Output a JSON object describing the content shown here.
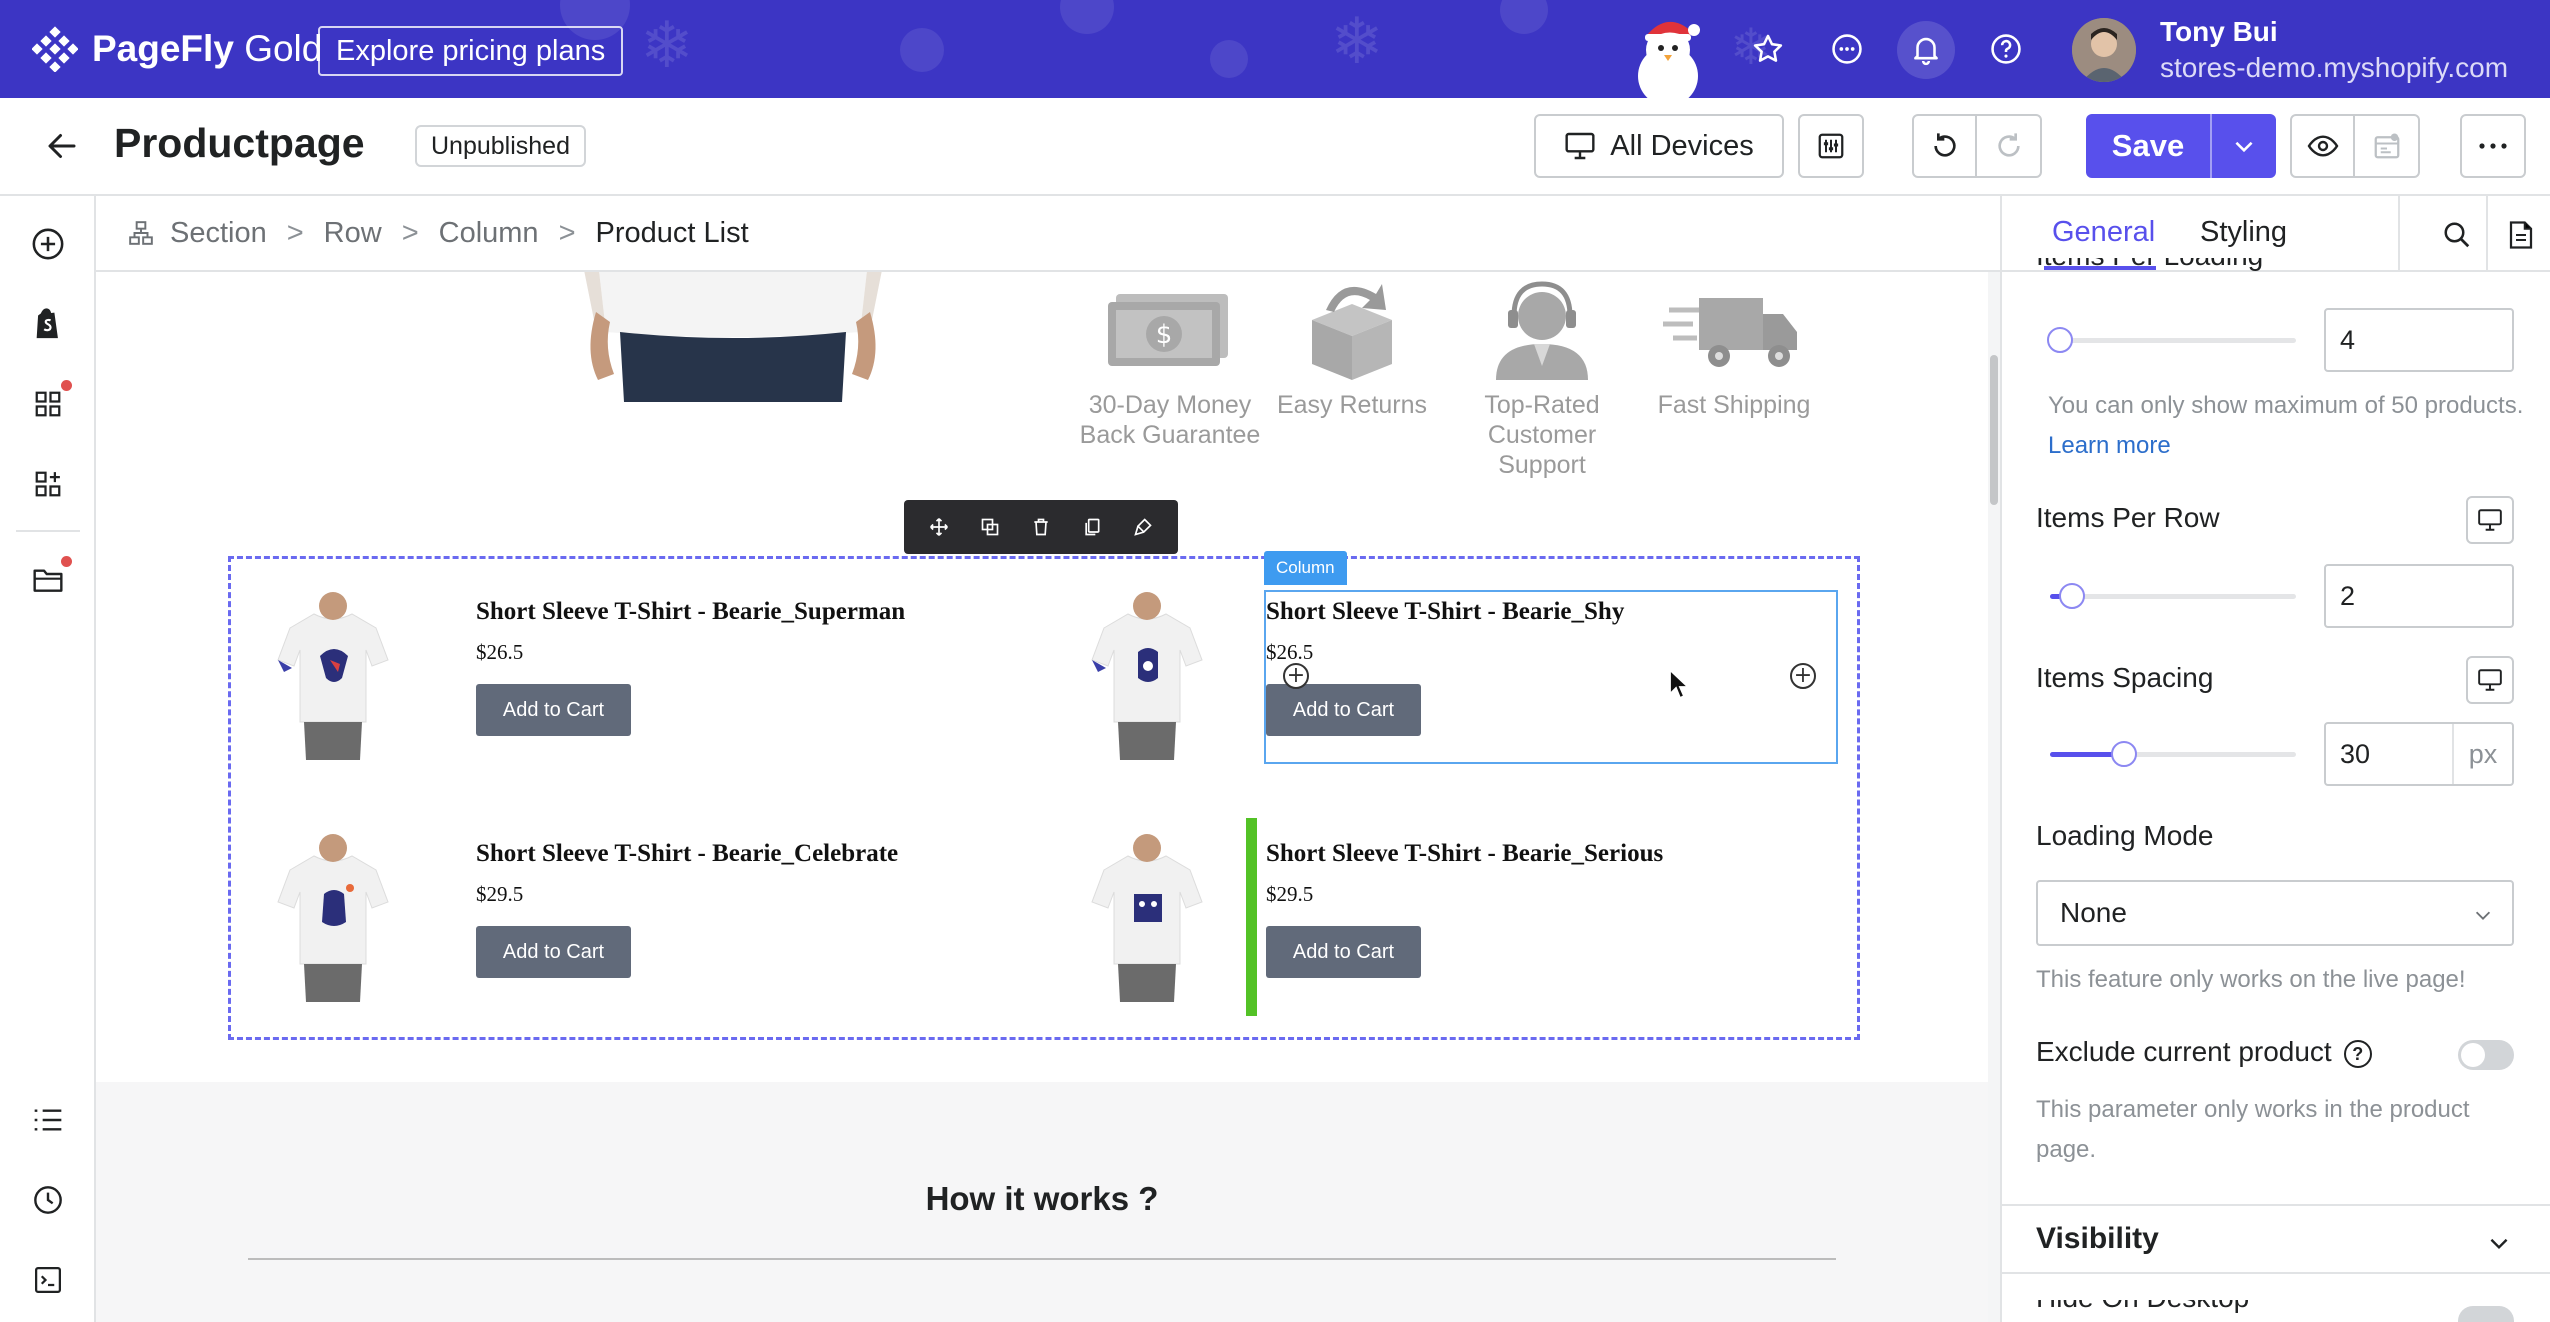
{
  "topbar": {
    "brand": "PageFly",
    "brand_tier": "Gold",
    "pricing_button": "Explore pricing plans",
    "user_name": "Tony Bui",
    "user_store": "stores-demo.myshopify.com"
  },
  "header": {
    "page_title": "Productpage",
    "status_badge": "Unpublished",
    "devices_button": "All Devices",
    "save_button": "Save"
  },
  "breadcrumb": {
    "items": [
      "Section",
      "Row",
      "Column",
      "Product List"
    ]
  },
  "canvas": {
    "features": [
      {
        "line1": "30-Day Money",
        "line2": "Back Guarantee"
      },
      {
        "line1": "Easy Returns",
        "line2": ""
      },
      {
        "line1": "Top-Rated",
        "line2": "Customer Support"
      },
      {
        "line1": "Fast Shipping",
        "line2": ""
      }
    ],
    "column_tag": "Column",
    "products": [
      {
        "name": "Short Sleeve T-Shirt - Bearie_Superman",
        "price": "$26.5",
        "button": "Add to Cart"
      },
      {
        "name": "Short Sleeve T-Shirt - Bearie_Shy",
        "price": "$26.5",
        "button": "Add to Cart"
      },
      {
        "name": "Short Sleeve T-Shirt - Bearie_Celebrate",
        "price": "$29.5",
        "button": "Add to Cart"
      },
      {
        "name": "Short Sleeve T-Shirt - Bearie_Serious",
        "price": "$29.5",
        "button": "Add to Cart"
      }
    ],
    "how_title": "How it works ?"
  },
  "panel": {
    "tabs": [
      "General",
      "Styling"
    ],
    "items_per_loading_label": "Items Per Loading",
    "items_per_loading_value": "4",
    "items_per_loading_slider": 0.04,
    "max_help": "You can only show maximum of 50 products.",
    "learn_more": "Learn more",
    "items_per_row_label": "Items Per Row",
    "items_per_row_value": "2",
    "items_per_row_slider": 0.09,
    "items_spacing_label": "Items Spacing",
    "items_spacing_value": "30",
    "items_spacing_unit": "px",
    "items_spacing_slider": 0.3,
    "loading_mode_label": "Loading Mode",
    "loading_mode_value": "None",
    "loading_mode_help": "This feature only works on the live page!",
    "exclude_label": "Exclude current product",
    "exclude_on": false,
    "exclude_help": "This parameter only works in the product page.",
    "visibility_title": "Visibility",
    "hide_desktop_label": "Hide On Desktop"
  },
  "colors": {
    "brand_purple": "#3c35c4",
    "accent": "#5850ec",
    "add_to_cart": "#616a7a",
    "column_highlight": "#3e9bf0",
    "drop_indicator": "#53c226"
  }
}
